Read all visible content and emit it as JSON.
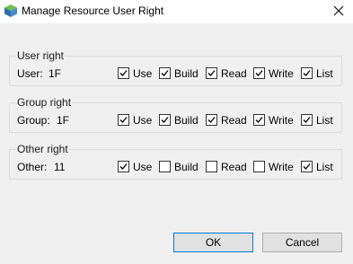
{
  "window": {
    "title": "Manage Resource User Right"
  },
  "groups": [
    {
      "legend": "User right",
      "label": "User:",
      "value": "1F",
      "perms": [
        {
          "label": "Use",
          "checked": true
        },
        {
          "label": "Build",
          "checked": true
        },
        {
          "label": "Read",
          "checked": true
        },
        {
          "label": "Write",
          "checked": true
        },
        {
          "label": "List",
          "checked": true
        }
      ]
    },
    {
      "legend": "Group right",
      "label": "Group:",
      "value": "1F",
      "perms": [
        {
          "label": "Use",
          "checked": true
        },
        {
          "label": "Build",
          "checked": true
        },
        {
          "label": "Read",
          "checked": true
        },
        {
          "label": "Write",
          "checked": true
        },
        {
          "label": "List",
          "checked": true
        }
      ]
    },
    {
      "legend": "Other right",
      "label": "Other:",
      "value": "11",
      "perms": [
        {
          "label": "Use",
          "checked": true
        },
        {
          "label": "Build",
          "checked": false
        },
        {
          "label": "Read",
          "checked": false
        },
        {
          "label": "Write",
          "checked": false
        },
        {
          "label": "List",
          "checked": true
        }
      ]
    }
  ],
  "buttons": {
    "ok": "OK",
    "cancel": "Cancel"
  },
  "colors": {
    "accent": "#0078d7"
  }
}
